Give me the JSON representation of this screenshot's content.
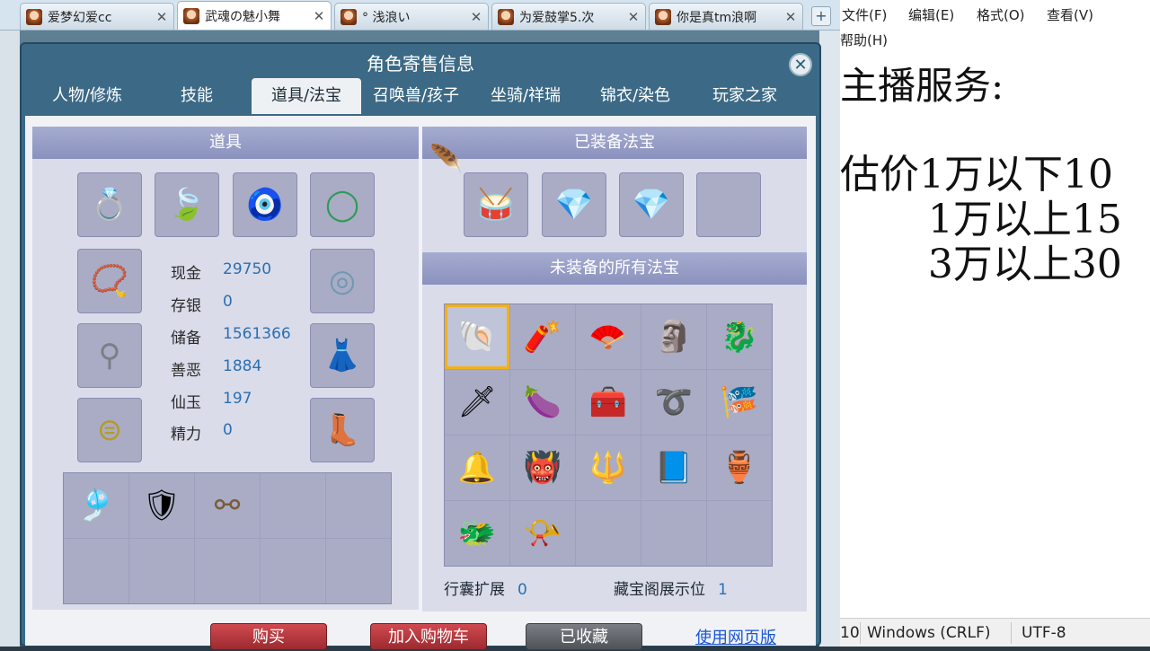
{
  "browser_tabs": [
    {
      "label": "爱梦幻爱cc",
      "active": false
    },
    {
      "label": "武魂の魅小舞",
      "active": true
    },
    {
      "label": "° 浅浪い",
      "active": false
    },
    {
      "label": "为爱鼓掌5.次",
      "active": false
    },
    {
      "label": "你是真tm浪啊",
      "active": false
    }
  ],
  "tab_close_glyph": "✕",
  "tab_add_glyph": "+",
  "dialog": {
    "title": "角色寄售信息",
    "close_glyph": "✕",
    "tabs": [
      "人物/修炼",
      "技能",
      "道具/法宝",
      "召唤兽/孩子",
      "坐骑/祥瑞",
      "锦衣/染色",
      "玩家之家"
    ],
    "active_tab": "道具/法宝"
  },
  "items_panel": {
    "header": "道具",
    "stats": [
      {
        "label": "现金",
        "value": "29750"
      },
      {
        "label": "存银",
        "value": "0"
      },
      {
        "label": "储备",
        "value": "1561366"
      },
      {
        "label": "善恶",
        "value": "1884"
      },
      {
        "label": "仙玉",
        "value": "197"
      },
      {
        "label": "精力",
        "value": "0"
      }
    ],
    "equipment_icons": [
      "ring-flower-icon",
      "leaf-pendant-icon",
      "amulet-icon",
      "jade-bangle-icon",
      "beaded-necklace-icon",
      "silver-bracelet-icon",
      "hook-necklace-icon",
      "skirt-armor-icon",
      "gold-belt-icon",
      "boots-icon"
    ],
    "bag_icons": [
      "tassel-charm-icon",
      "gold-armor-icon",
      "hook-chain-icon"
    ]
  },
  "equipped_treasures": {
    "header": "已装备法宝",
    "icons": [
      "drum-icon",
      "crystal-lamp-icon",
      "crystal-lamp-icon"
    ]
  },
  "all_treasures": {
    "header": "未装备的所有法宝",
    "icons": [
      "shell-icon",
      "firework-icon",
      "fan-icon",
      "totem-icon",
      "jade-beast-icon",
      "sword-icon",
      "gourd-icon",
      "box-icon",
      "golden-rope-icon",
      "banner-icon",
      "bell-icon",
      "demon-mask-icon",
      "spear-icon",
      "book-icon",
      "lotus-bowl-icon",
      "dragon-icon",
      "horn-bell-icon"
    ]
  },
  "footer": {
    "bag_expand_label": "行囊扩展",
    "bag_expand_value": "0",
    "treasure_display_label": "藏宝阁展示位",
    "treasure_display_value": "1"
  },
  "buttons": {
    "buy": "购买",
    "add_cart": "加入购物车",
    "favorited": "已收藏",
    "web_version": "使用网页版"
  },
  "notepad": {
    "menu": [
      "文件(F)",
      "编辑(E)",
      "格式(O)",
      "查看(V)",
      "帮助(H)"
    ],
    "lines": [
      "主播服务:",
      "",
      "估价1万以下10",
      "       1万以上15",
      "       3万以上30"
    ],
    "status_line_col": "10",
    "status_eol": "Windows (CRLF)",
    "status_encoding": "UTF-8"
  }
}
